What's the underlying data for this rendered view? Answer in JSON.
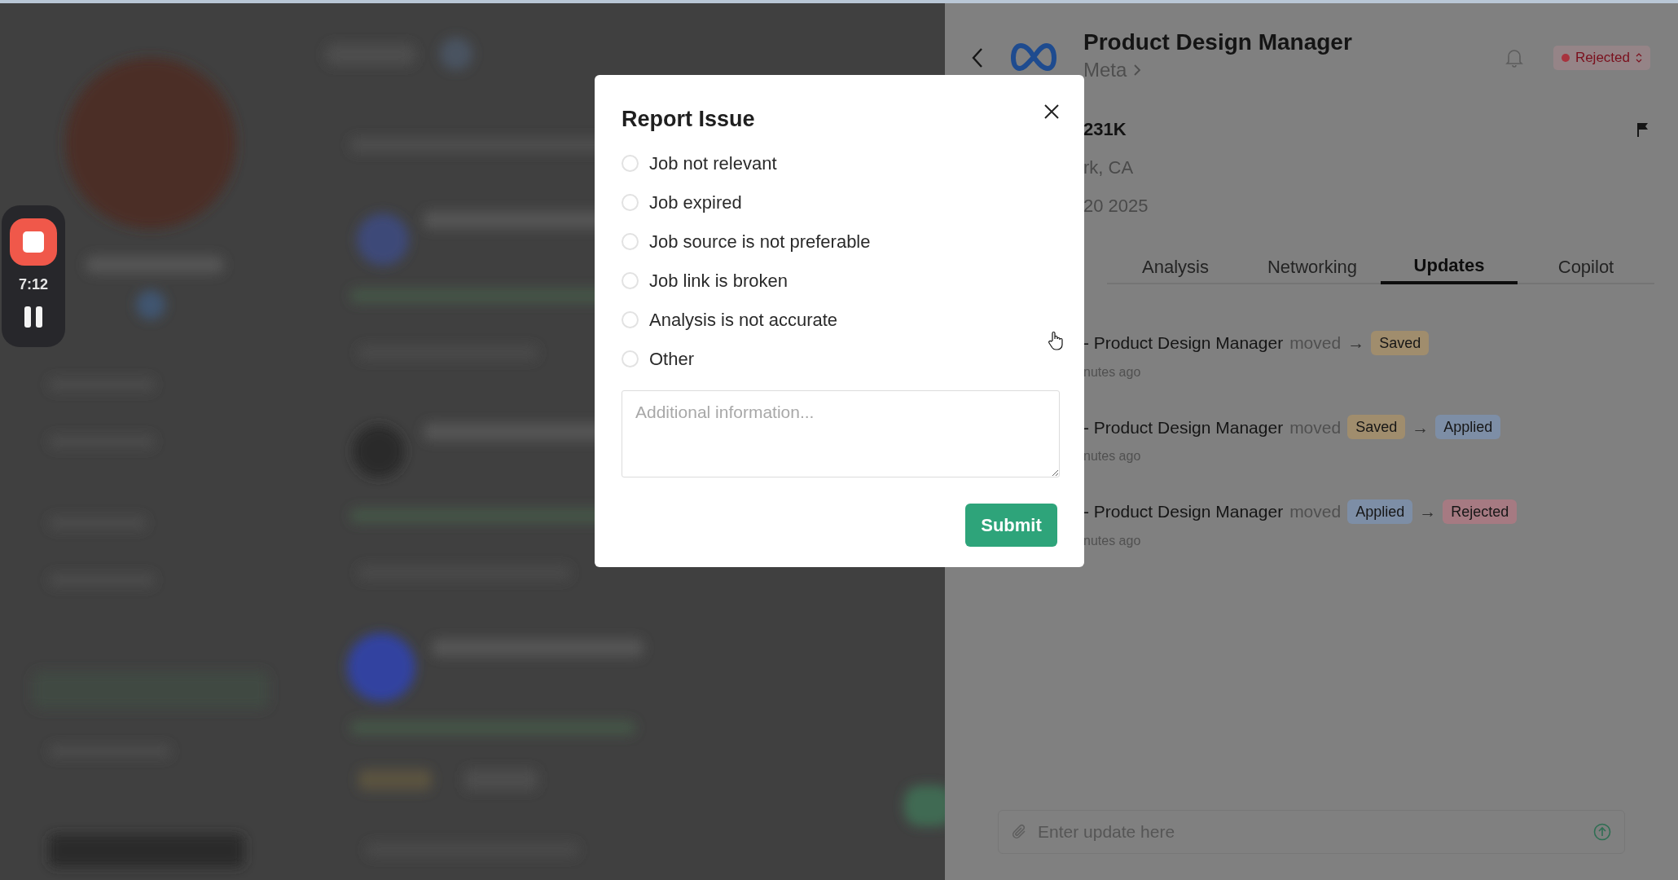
{
  "recorder": {
    "time": "7:12"
  },
  "job": {
    "title": "Product Design Manager",
    "company": "Meta",
    "status": "Rejected",
    "salary": "231K",
    "location": "rk, CA",
    "date": "20 2025"
  },
  "tabs": [
    {
      "label": "Analysis",
      "selected": false
    },
    {
      "label": "Networking",
      "selected": false
    },
    {
      "label": "Updates",
      "selected": true
    },
    {
      "label": "Copilot",
      "selected": false
    }
  ],
  "updates": [
    {
      "text": "- Product Design Manager",
      "verb": "moved",
      "arrow": "→",
      "statuses": [
        {
          "label": "Saved",
          "color": "#a08d6d"
        }
      ],
      "time": "nutes ago"
    },
    {
      "text": "- Product Design Manager",
      "verb": "moved",
      "arrow": "→",
      "statuses": [
        {
          "label": "Saved",
          "color": "#a08d6d"
        },
        {
          "label": "Applied",
          "color": "#7d8ea6"
        }
      ],
      "time": "nutes ago"
    },
    {
      "text": "- Product Design Manager",
      "verb": "moved",
      "arrow": "→",
      "statuses": [
        {
          "label": "Applied",
          "color": "#7d8ea6"
        },
        {
          "label": "Rejected",
          "color": "#a67a82"
        }
      ],
      "time": "nutes ago"
    }
  ],
  "composer": {
    "placeholder": "Enter update here"
  },
  "modal": {
    "title": "Report Issue",
    "options": [
      {
        "label": "Job not relevant",
        "selected": false
      },
      {
        "label": "Job expired",
        "selected": false
      },
      {
        "label": "Job source is not preferable",
        "selected": false
      },
      {
        "label": "Job link is broken",
        "selected": false
      },
      {
        "label": "Analysis is not accurate",
        "selected": false
      },
      {
        "label": "Other",
        "selected": false
      }
    ],
    "placeholder": "Additional information...",
    "submit": "Submit"
  }
}
